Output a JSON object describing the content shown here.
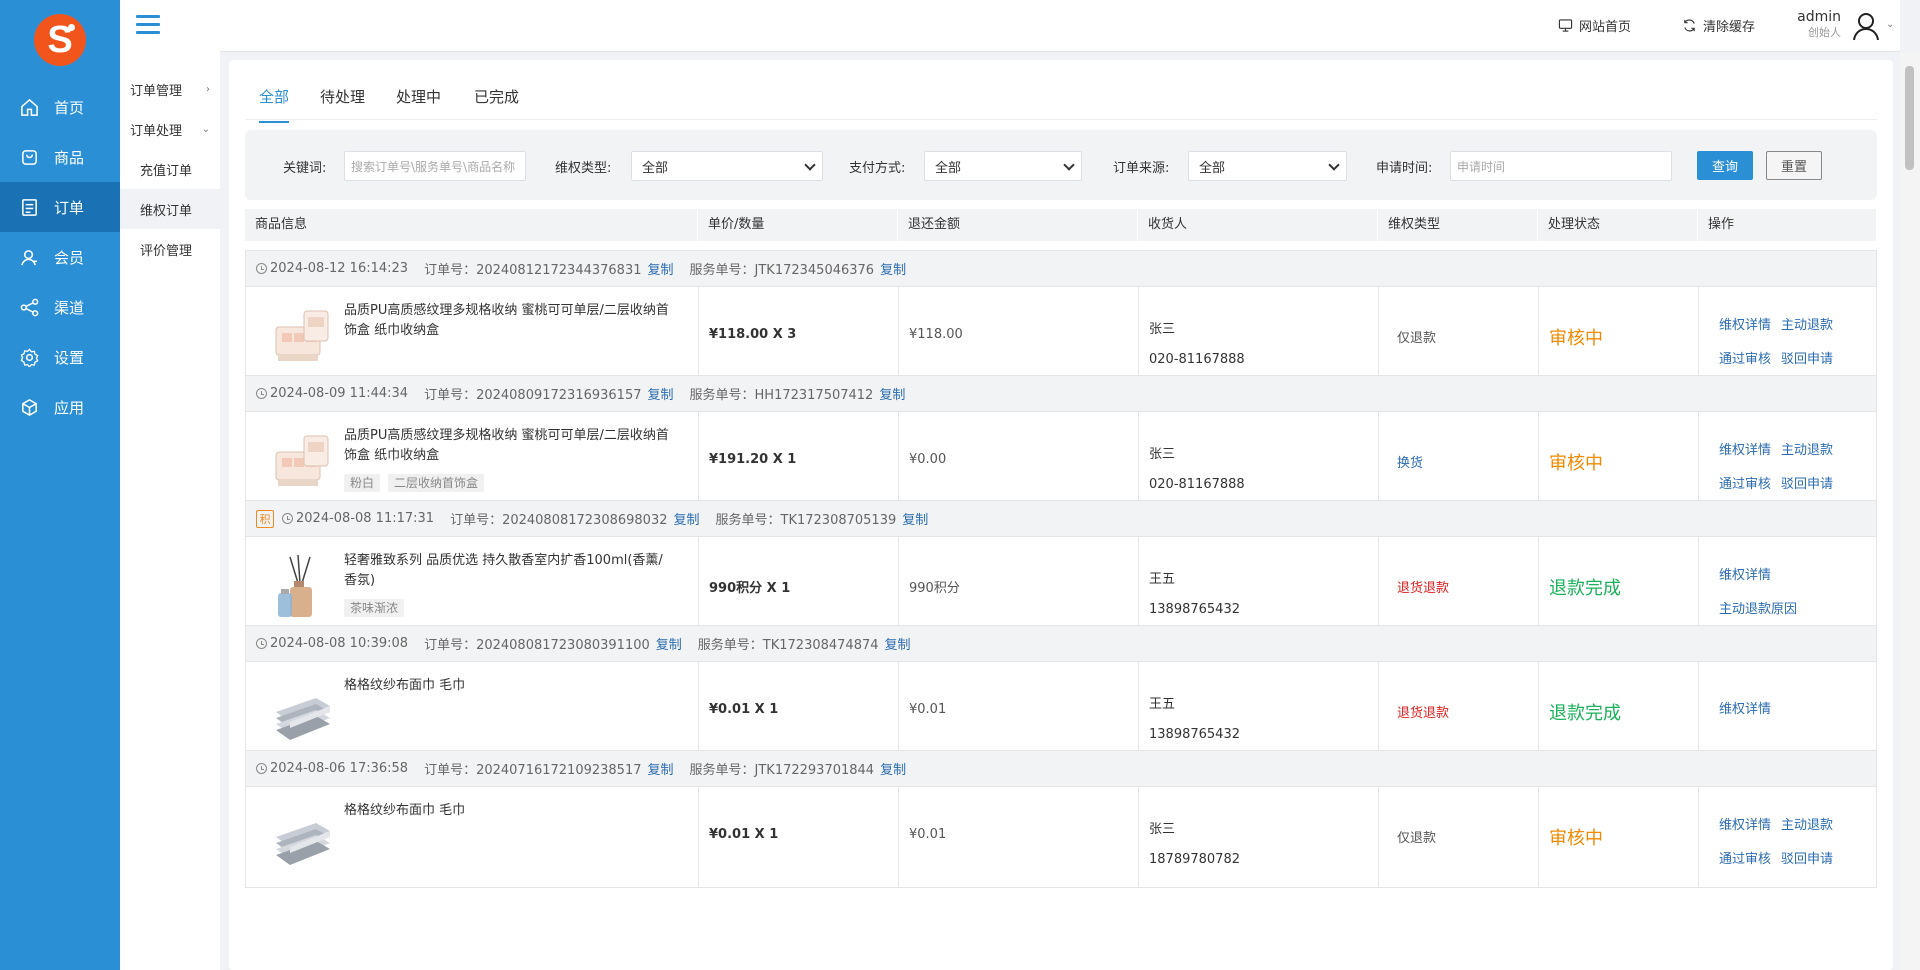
{
  "sidebar": {
    "logo_letter": "S",
    "items": [
      {
        "label": "首页",
        "icon": "home-icon"
      },
      {
        "label": "商品",
        "icon": "goods-icon"
      },
      {
        "label": "订单",
        "icon": "order-icon",
        "active": true
      },
      {
        "label": "会员",
        "icon": "member-icon"
      },
      {
        "label": "渠道",
        "icon": "channel-icon"
      },
      {
        "label": "设置",
        "icon": "settings-icon"
      },
      {
        "label": "应用",
        "icon": "app-icon"
      }
    ]
  },
  "subnav": {
    "groups": [
      {
        "label": "订单管理",
        "chev": "›"
      },
      {
        "label": "订单处理",
        "chev": "⌄"
      }
    ],
    "items": [
      "充值订单",
      "维权订单",
      "评价管理"
    ]
  },
  "topbar": {
    "site_home": "网站首页",
    "clear_cache": "清除缓存",
    "user_name": "admin",
    "user_role": "创始人"
  },
  "tabs": [
    "全部",
    "待处理",
    "处理中",
    "已完成"
  ],
  "filter": {
    "keyword_label": "关键词:",
    "keyword_placeholder": "搜索订单号\\服务单号\\商品名称",
    "type_label": "维权类型:",
    "type_value": "全部",
    "pay_label": "支付方式:",
    "pay_value": "全部",
    "source_label": "订单来源:",
    "source_value": "全部",
    "time_label": "申请时间:",
    "time_placeholder": "申请时间",
    "query_button": "查询",
    "reset_button": "重置"
  },
  "table": {
    "headers": [
      "商品信息",
      "单价/数量",
      "退还金额",
      "收货人",
      "维权类型",
      "处理状态",
      "操作"
    ]
  },
  "orders": [
    {
      "points": "",
      "time": "2024-08-12 16:14:23",
      "order_no": "订单号：20240812172344376831",
      "copy1": "复制",
      "service_no": "服务单号：JTK172345046376",
      "copy2": "复制",
      "image": "jewelry-box",
      "name": "品质PU高质感纹理多规格收纳 蜜桃可可单层/二层收纳首饰盒 纸巾收纳盒",
      "tags": [],
      "price": "¥118.00 X 3",
      "refund": "¥118.00",
      "receiver": "张三",
      "phone": "020-81167888",
      "type": "仅退款",
      "type_color": "#555555",
      "status": "审核中",
      "status_color": "#f08a00",
      "ops": [
        "维权详情",
        "主动退款",
        "通过审核",
        "驳回申请"
      ]
    },
    {
      "points": "",
      "time": "2024-08-09 11:44:34",
      "order_no": "订单号：20240809172316936157",
      "copy1": "复制",
      "service_no": "服务单号：HH172317507412",
      "copy2": "复制",
      "image": "jewelry-box",
      "name": "品质PU高质感纹理多规格收纳 蜜桃可可单层/二层收纳首饰盒 纸巾收纳盒",
      "tags": [
        "粉白",
        "二层收纳首饰盒"
      ],
      "price": "¥191.20 X 1",
      "refund": "¥0.00",
      "receiver": "张三",
      "phone": "020-81167888",
      "type": "换货",
      "type_color": "#2b6cb0",
      "status": "审核中",
      "status_color": "#f08a00",
      "ops": [
        "维权详情",
        "主动退款",
        "通过审核",
        "驳回申请"
      ]
    },
    {
      "points": "积",
      "time": "2024-08-08 11:17:31",
      "order_no": "订单号：20240808172308698032",
      "copy1": "复制",
      "service_no": "服务单号：TK172308705139",
      "copy2": "复制",
      "image": "diffuser",
      "name": "轻奢雅致系列 品质优选 持久散香室内扩香100ml(香薰/香氛)",
      "tags": [
        "茶味渐浓"
      ],
      "price": "990积分 X 1",
      "refund": "990积分",
      "receiver": "王五",
      "phone": "13898765432",
      "type": "退货退款",
      "type_color": "#e02020",
      "status": "退款完成",
      "status_color": "#19b25a",
      "ops": [
        "维权详情",
        "主动退款原因"
      ]
    },
    {
      "points": "",
      "time": "2024-08-08 10:39:08",
      "order_no": "订单号：20240808172308039110​0",
      "copy1": "复制",
      "service_no": "服务单号：TK172308474874",
      "copy2": "复制",
      "image": "towel",
      "name": "格格纹纱布面巾 毛巾",
      "tags": [],
      "price": "¥0.01 X 1",
      "refund": "¥0.01",
      "receiver": "王五",
      "phone": "13898765432",
      "type": "退货退款",
      "type_color": "#e02020",
      "status": "退款完成",
      "status_color": "#19b25a",
      "ops": [
        "维权详情"
      ]
    },
    {
      "points": "",
      "time": "2024-08-06 17:36:58",
      "order_no": "订单号：20240716172109238517",
      "copy1": "复制",
      "service_no": "服务单号：JTK172293701844",
      "copy2": "复制",
      "image": "towel",
      "name": "格格纹纱布面巾 毛巾",
      "tags": [],
      "price": "¥0.01 X 1",
      "refund": "¥0.01",
      "receiver": "张三",
      "phone": "18789780782",
      "type": "仅退款",
      "type_color": "#555555",
      "status": "审核中",
      "status_color": "#f08a00",
      "ops": [
        "维权详情",
        "主动退款",
        "通过审核",
        "驳回申请"
      ]
    }
  ]
}
